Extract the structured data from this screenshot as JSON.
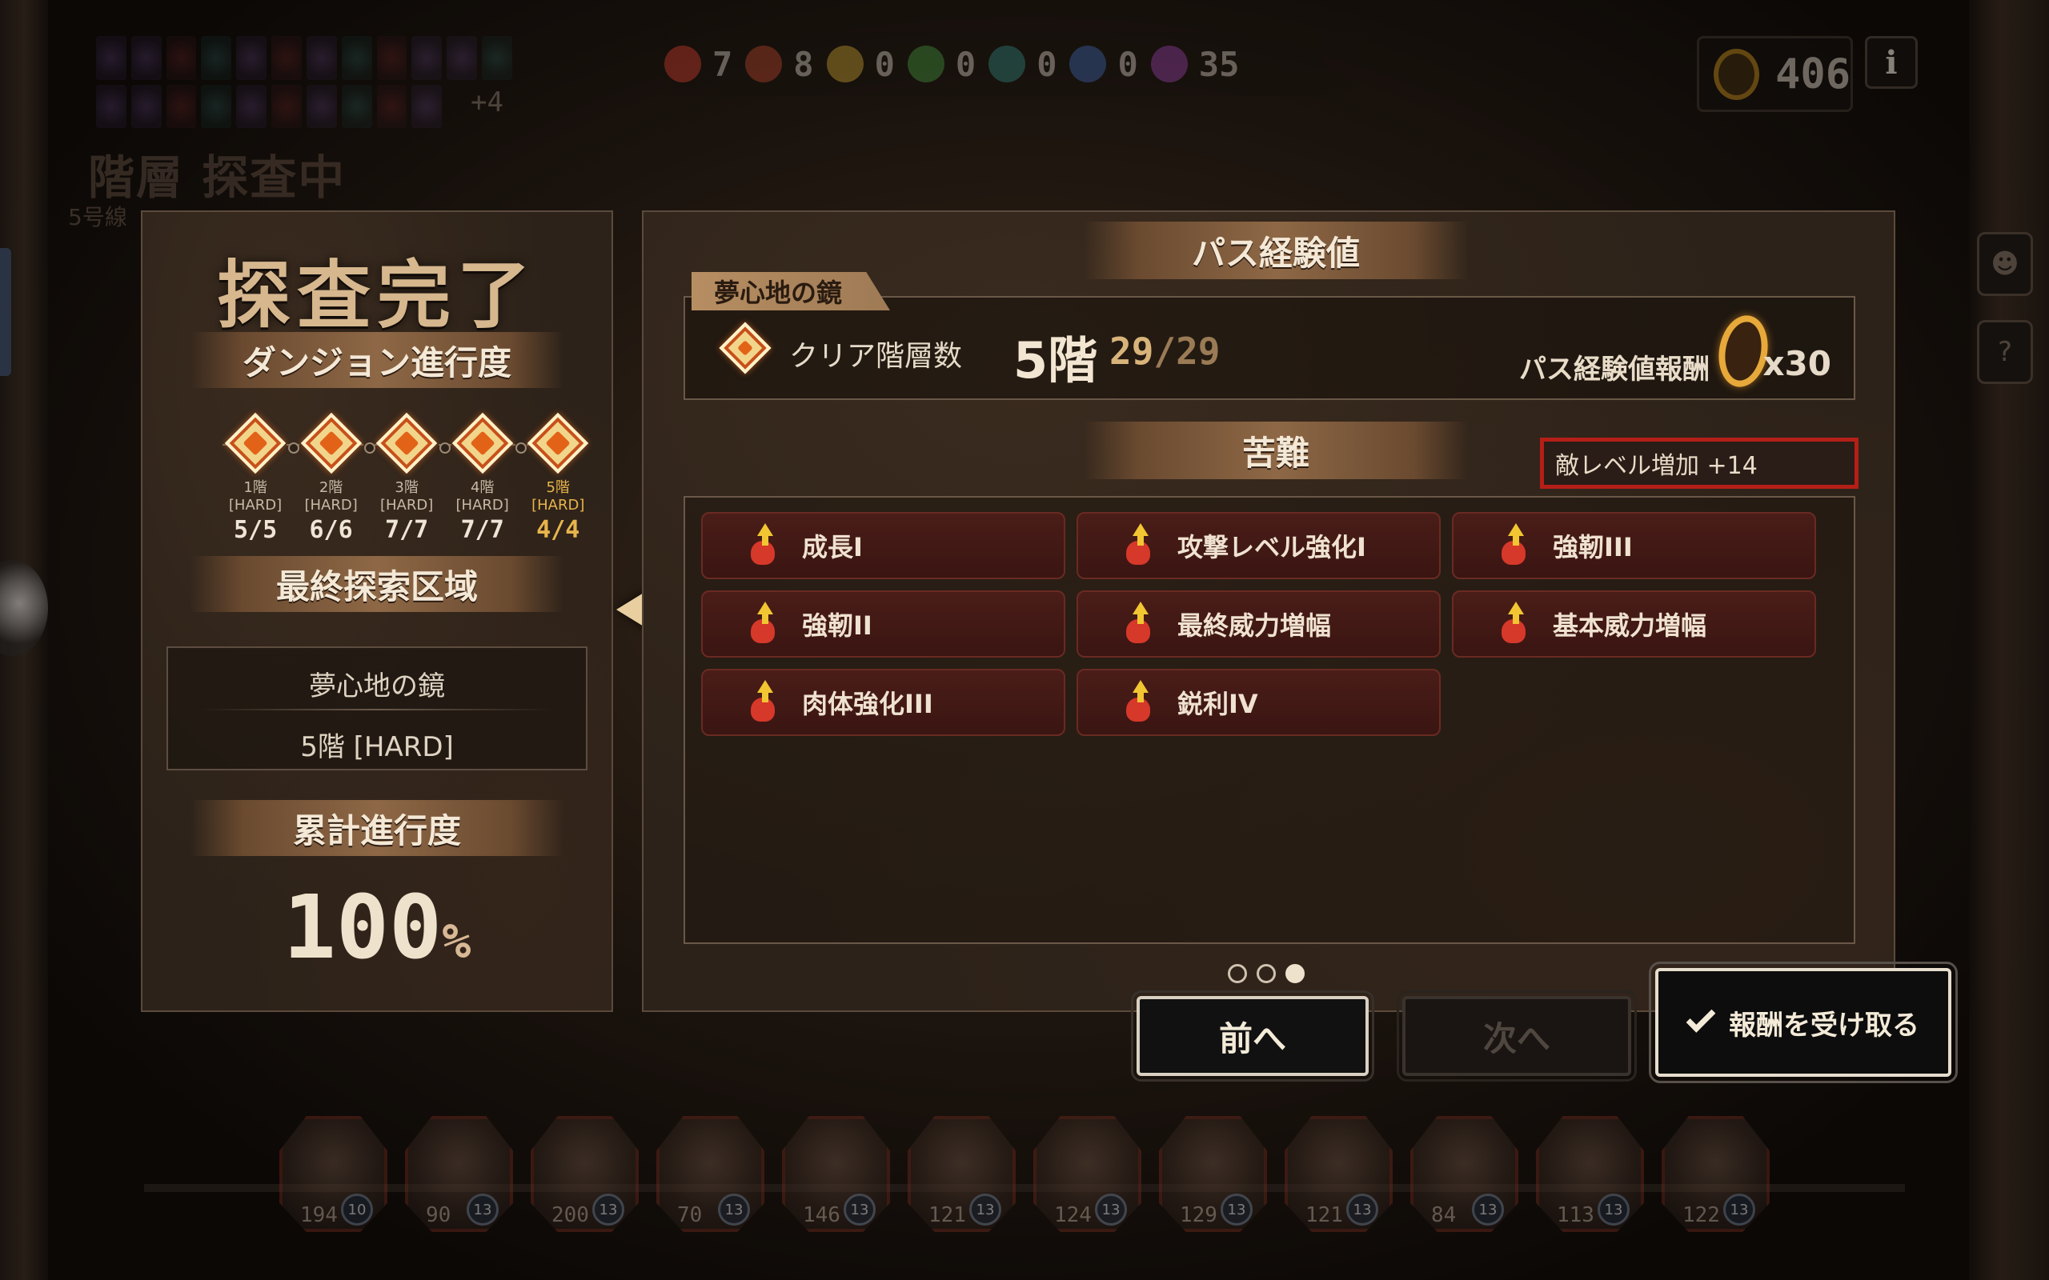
{
  "top_bar": {
    "relic_extra": "+4",
    "resources": [
      {
        "icon": "red-ember-icon",
        "color": "#c0392b",
        "value": "7"
      },
      {
        "icon": "crimson-gear-icon",
        "color": "#a8402a",
        "value": "8"
      },
      {
        "icon": "amber-ore-icon",
        "color": "#b8952e",
        "value": "0"
      },
      {
        "icon": "green-leaf-icon",
        "color": "#3f8a3a",
        "value": "0"
      },
      {
        "icon": "teal-shell-icon",
        "color": "#2f7a74",
        "value": "0"
      },
      {
        "icon": "blue-crystal-icon",
        "color": "#3a5fa0",
        "value": "0"
      },
      {
        "icon": "violet-gem-icon",
        "color": "#8a3c9a",
        "value": "35"
      }
    ],
    "currency": {
      "value": "406"
    },
    "info_label": "i"
  },
  "background": {
    "floor_title": "階層 探査中",
    "floor_sub": "5号線"
  },
  "left_panel": {
    "title": "探査完了",
    "progress_heading": "ダンジョン進行度",
    "floors": [
      {
        "label": "1階",
        "mode": "[HARD]",
        "count": "5/5"
      },
      {
        "label": "2階",
        "mode": "[HARD]",
        "count": "6/6"
      },
      {
        "label": "3階",
        "mode": "[HARD]",
        "count": "7/7"
      },
      {
        "label": "4階",
        "mode": "[HARD]",
        "count": "7/7"
      },
      {
        "label": "5階",
        "mode": "[HARD]",
        "count": "4/4"
      }
    ],
    "area_heading": "最終探索区域",
    "area_name": "夢心地の鏡",
    "area_floor": "5階 [HARD]",
    "total_heading": "累計進行度",
    "total_value": "100",
    "total_unit": "%"
  },
  "right_panel": {
    "exp_heading": "パス経験値",
    "dungeon_tag": "夢心地の鏡",
    "clear_label": "クリア階層数",
    "clear_floor": "5階",
    "clear_done": "29",
    "clear_total": "/29",
    "reward_label": "パス経験値報酬",
    "reward_mult": "x30",
    "hardship_heading": "苦難",
    "enemy_level": "敵レベル増加 +14",
    "hardships": [
      "成長I",
      "攻撃レベル強化I",
      "強靭III",
      "強靭II",
      "最終威力増幅",
      "基本威力増幅",
      "肉体強化III",
      "鋭利IV"
    ],
    "page_count": 3,
    "page_active": 3
  },
  "buttons": {
    "prev": "前へ",
    "next": "次へ",
    "claim": "報酬を受け取る"
  },
  "party": [
    {
      "level": "194",
      "badge": "10"
    },
    {
      "level": "90",
      "badge": "13"
    },
    {
      "level": "200",
      "badge": "13"
    },
    {
      "level": "70",
      "badge": "13"
    },
    {
      "level": "146",
      "badge": "13"
    },
    {
      "level": "121",
      "badge": "13"
    },
    {
      "level": "124",
      "badge": "13"
    },
    {
      "level": "129",
      "badge": "13"
    },
    {
      "level": "121",
      "badge": "13"
    },
    {
      "level": "84",
      "badge": "13"
    },
    {
      "level": "113",
      "badge": "13"
    },
    {
      "level": "122",
      "badge": "13"
    }
  ]
}
